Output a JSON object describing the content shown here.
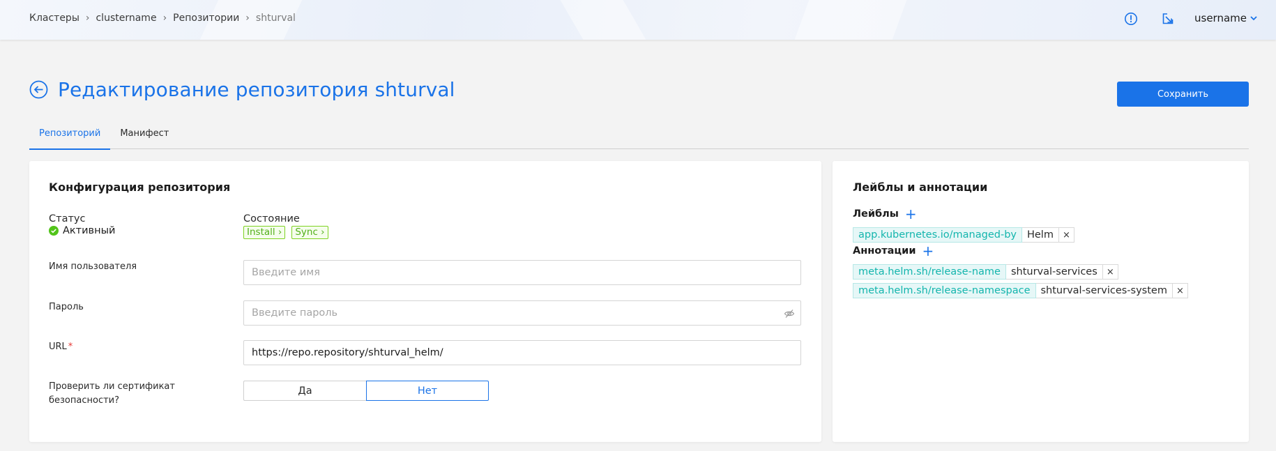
{
  "colors": {
    "accent": "#1a73e8",
    "tag_green": "#52b01a",
    "key_teal": "#13b5ad",
    "required": "#e53935"
  },
  "header": {
    "breadcrumbs": [
      "Кластеры",
      "clustername",
      "Репозитории",
      "shturval"
    ],
    "icons": [
      "alert-circle-icon",
      "external-link-icon"
    ],
    "username": "username"
  },
  "page": {
    "title": "Редактирование репозитория shturval",
    "save_label": "Сохранить",
    "tabs": [
      "Репозиторий",
      "Манифест"
    ]
  },
  "config": {
    "title": "Конфигурация репозитория",
    "status_label": "Статус",
    "status_value": "Активный",
    "state_label": "Состояние",
    "state_tags": [
      "Install",
      "Sync"
    ],
    "username_label": "Имя пользователя",
    "username_placeholder": "Введите имя",
    "password_label": "Пароль",
    "password_placeholder": "Введите пароль",
    "url_label": "URL",
    "url_required": "*",
    "url_value": "https://repo.repository/shturval_helm/",
    "cert_label": "Проверить ли сертификат безопасности?",
    "cert_options": [
      "Да",
      "Нет"
    ],
    "cert_selected": "Нет"
  },
  "meta": {
    "title": "Лейблы и аннотации",
    "labels_title": "Лейблы",
    "labels": [
      {
        "key": "app.kubernetes.io/managed-by",
        "value": "Helm"
      }
    ],
    "annotations_title": "Аннотации",
    "annotations": [
      {
        "key": "meta.helm.sh/release-name",
        "value": "shturval-services"
      },
      {
        "key": "meta.helm.sh/release-namespace",
        "value": "shturval-services-system"
      }
    ],
    "add_symbol": "+",
    "remove_symbol": "×"
  }
}
